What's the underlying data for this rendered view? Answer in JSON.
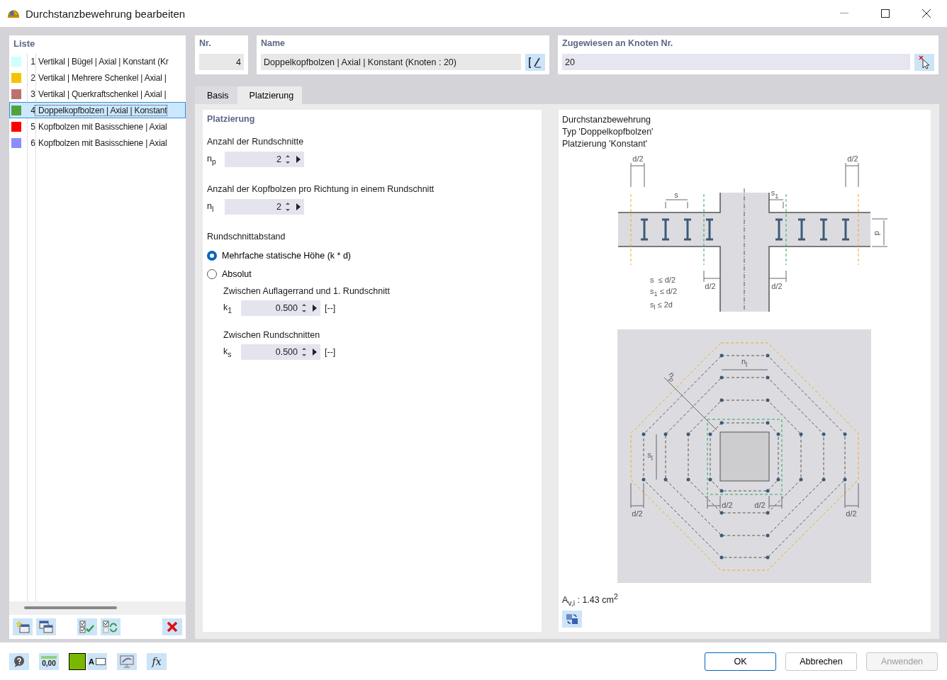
{
  "window": {
    "title": "Durchstanzbewehrung bearbeiten"
  },
  "list": {
    "title": "Liste",
    "items": [
      {
        "number": "1",
        "label": "Vertikal | Bügel | Axial | Konstant (Kr",
        "color": "#ccffff",
        "selected": false
      },
      {
        "number": "2",
        "label": "Vertikal | Mehrere Schenkel | Axial |",
        "color": "#f5c400",
        "selected": false
      },
      {
        "number": "3",
        "label": "Vertikal | Querkraftschenkel | Axial |",
        "color": "#bc7070",
        "selected": false
      },
      {
        "number": "4",
        "label": "Doppelkopfbolzen | Axial | Konstant",
        "color": "#52a23c",
        "selected": true
      },
      {
        "number": "5",
        "label": "Kopfbolzen mit Basisschiene | Axial",
        "color": "#ff0000",
        "selected": false
      },
      {
        "number": "6",
        "label": "Kopfbolzen mit Basisschiene | Axial",
        "color": "#8c8cff",
        "selected": false
      }
    ]
  },
  "number": {
    "label": "Nr.",
    "value": "4"
  },
  "name": {
    "label": "Name",
    "value": "Doppelkopfbolzen | Axial | Konstant (Knoten : 20)"
  },
  "assigned": {
    "label": "Zugewiesen an Knoten Nr.",
    "value": "20"
  },
  "tabs": [
    {
      "label": "Basis",
      "selected": false
    },
    {
      "label": "Platzierung",
      "selected": true
    }
  ],
  "placement": {
    "title": "Platzierung",
    "perimeters": {
      "label": "Anzahl der Rundschnitte",
      "symbol": "n$_{p}$",
      "value": "2"
    },
    "studs": {
      "label": "Anzahl der Kopfbolzen pro Richtung in einem Rundschnitt",
      "symbol": "n$_{l}$",
      "value": "2"
    },
    "spacing": {
      "label": "Rundschnittabstand",
      "options": [
        {
          "label": "Mehrfache statische Höhe (k * d)",
          "selected": true
        },
        {
          "label": "Absolut",
          "selected": false
        }
      ],
      "fields": [
        {
          "label": "Zwischen Auflagerrand und 1. Rundschnitt",
          "symbol": "k$_{1}$",
          "value": "0.500",
          "unit": "[--]"
        },
        {
          "label": "Zwischen Rundschnitten",
          "symbol": "k$_{s}$",
          "value": "0.500",
          "unit": "[--]"
        }
      ]
    }
  },
  "preview": {
    "lines": [
      "Durchstanzbewehrung",
      "Typ 'Doppelkopfbolzen'",
      "Platzierung 'Konstant'"
    ],
    "section_labels": [
      "d/2",
      "d/2",
      "s",
      "s$_{1}$",
      "d",
      "d/2",
      "d/2"
    ],
    "legend": [
      "s  ≤ d/2",
      "s$_{1}$ ≤ d/2",
      "s$_{l}$ ≤ 2d"
    ],
    "plan_labels": [
      "n$_{l}$",
      "n$_{p}$",
      "s$_{l}$",
      "d/2",
      "d/2",
      "d/2",
      "d/2"
    ],
    "result": "A$_{v,i}$ : 1.43 cm$^{2}$"
  },
  "tools": [
    {
      "kind": "help"
    },
    {
      "kind": "decimals",
      "text": "0,00"
    },
    {
      "kind": "color",
      "color": "#7ab800"
    },
    {
      "kind": "font",
      "text": "A"
    },
    {
      "kind": "display"
    },
    {
      "kind": "formula",
      "text": "fx"
    }
  ],
  "buttons": [
    {
      "label": "OK",
      "disabled": false
    },
    {
      "label": "Abbrechen",
      "disabled": false
    },
    {
      "label": "Anwenden",
      "disabled": true
    }
  ]
}
